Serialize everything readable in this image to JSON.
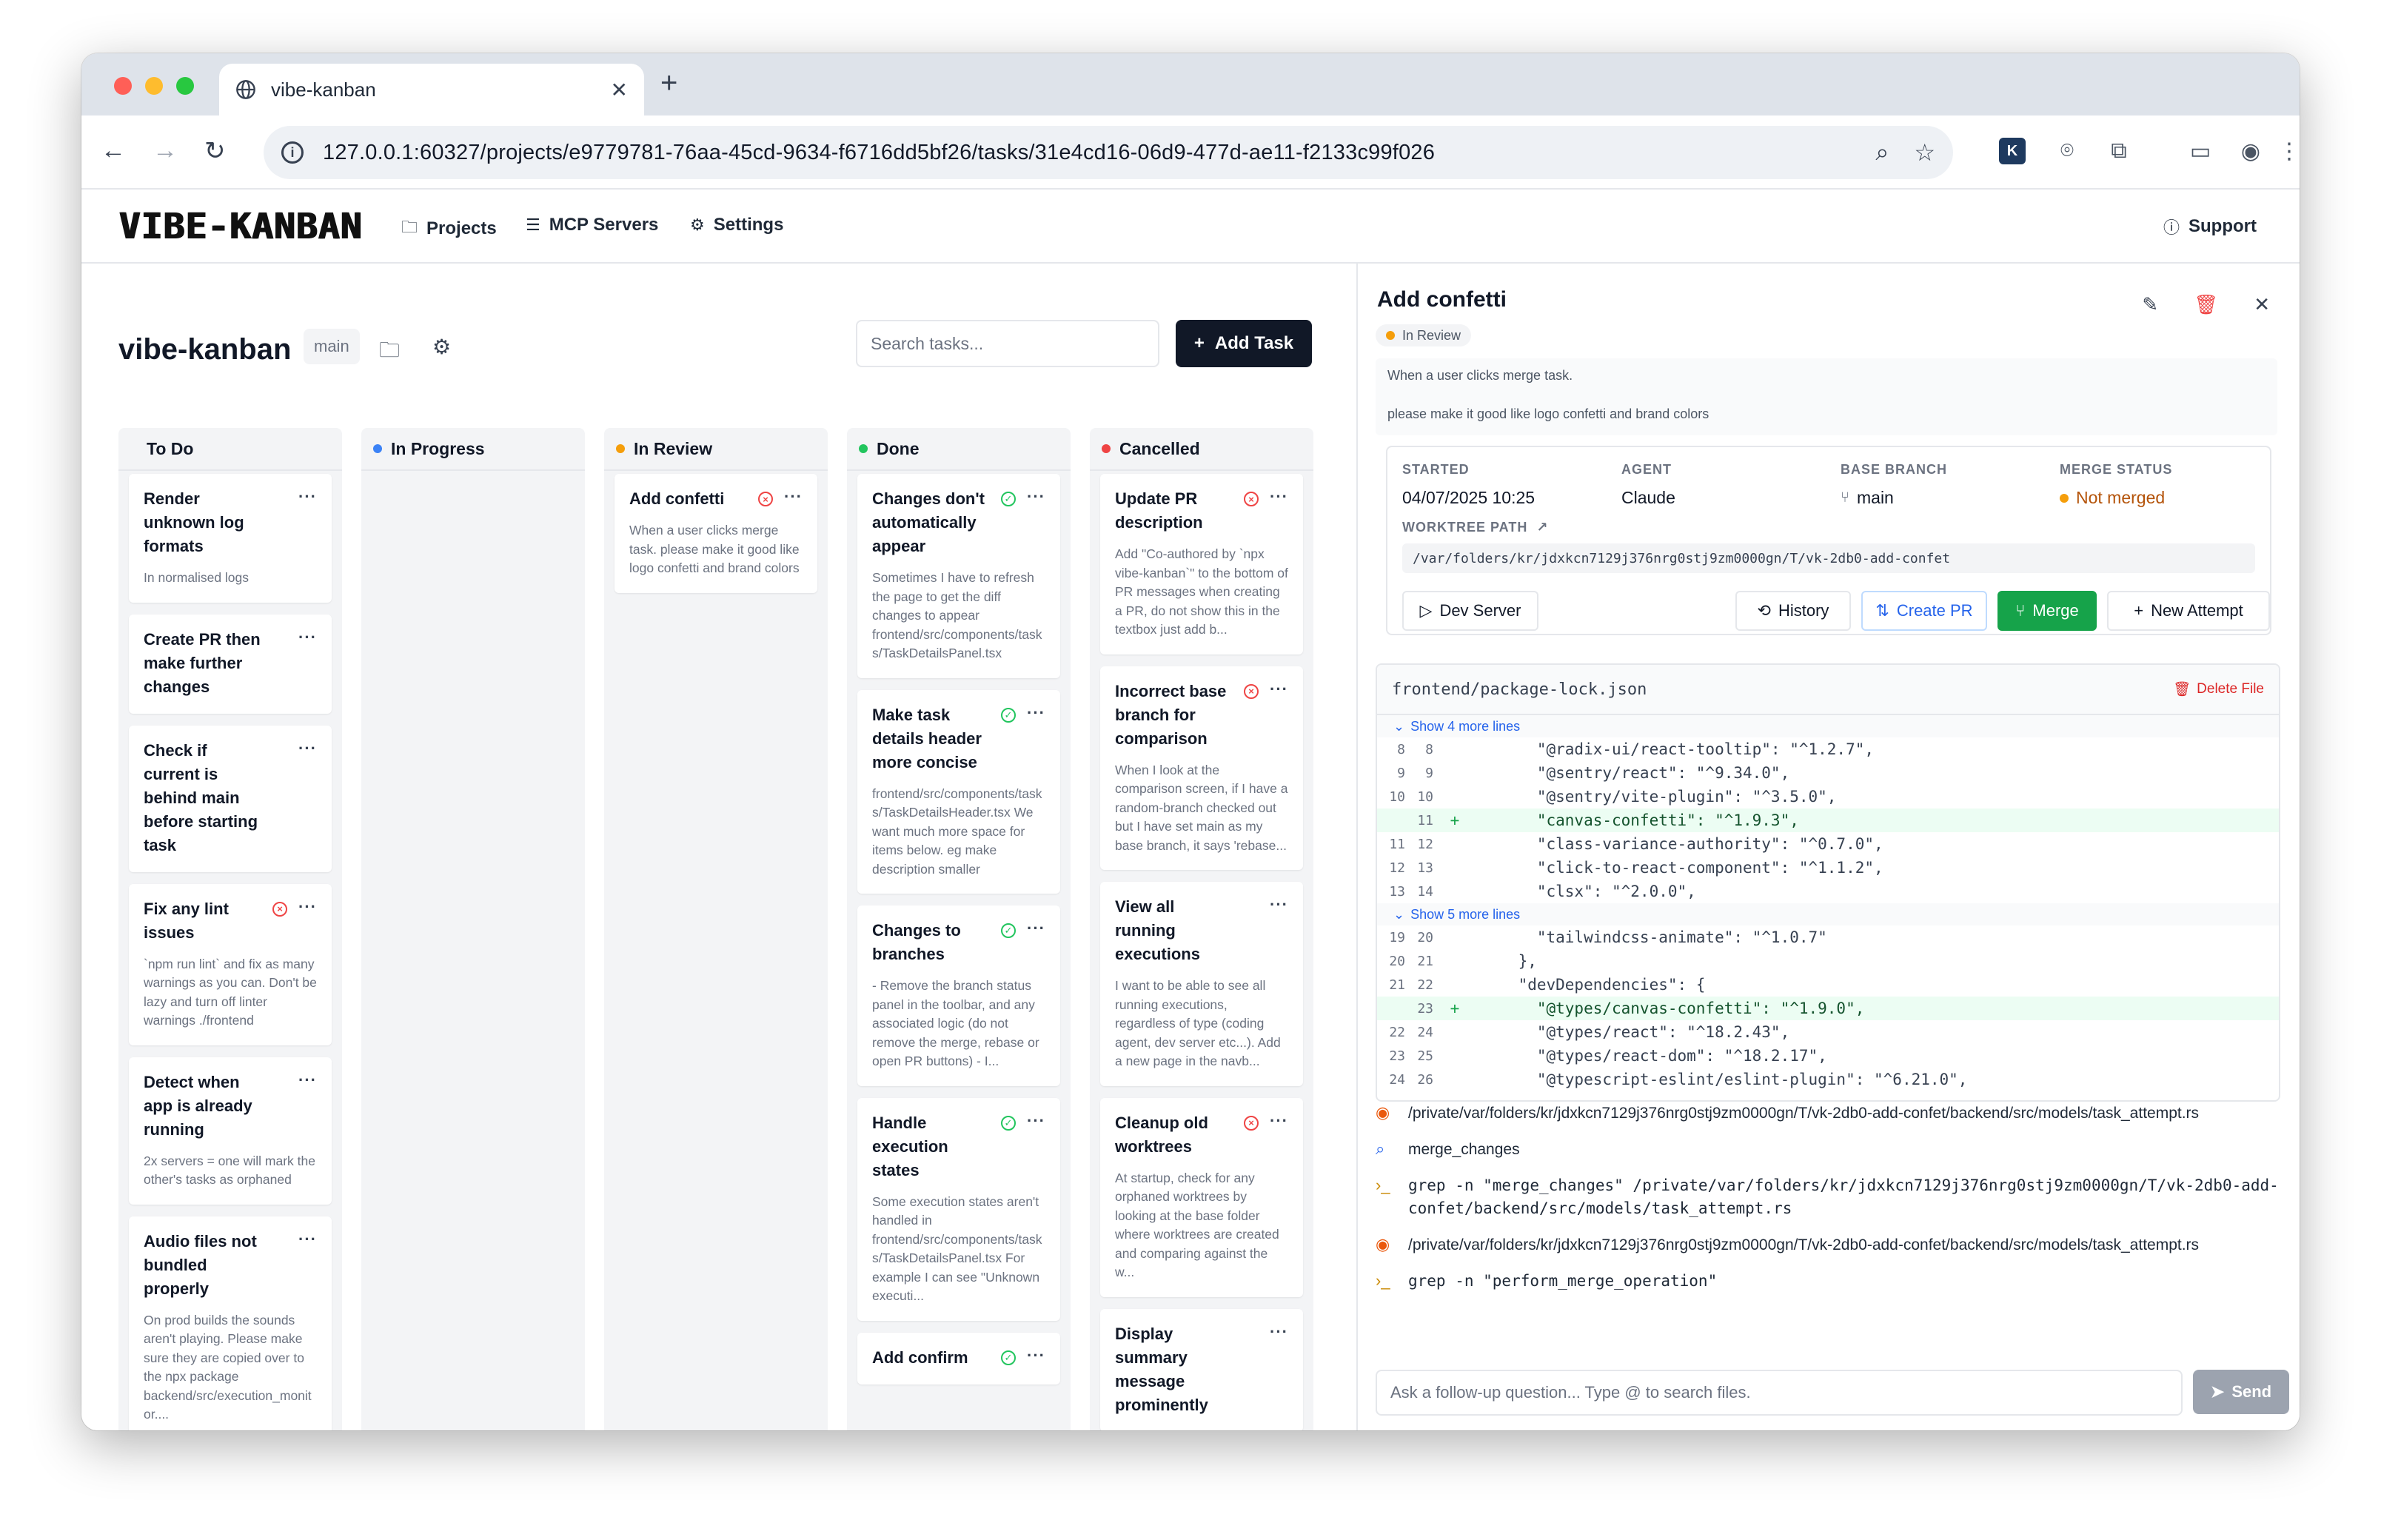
{
  "browser": {
    "tab_title": "vibe-kanban",
    "url": "127.0.0.1:60327/projects/e9779781-76aa-45cd-9634-f6716dd5bf26/tasks/31e4cd16-06d9-477d-ae11-f2133c99f026"
  },
  "app": {
    "logo": "VIBE-KANBAN",
    "nav": {
      "projects": "Projects",
      "mcp": "MCP Servers",
      "settings": "Settings",
      "support": "Support"
    }
  },
  "project": {
    "name": "vibe-kanban",
    "branch": "main",
    "search_placeholder": "Search tasks...",
    "add_task": "Add Task"
  },
  "colors": {
    "todo": "#9ca3af",
    "inprogress": "#3b82f6",
    "inreview": "#f59e0b",
    "done": "#22c55e",
    "cancelled": "#ef4444",
    "merge": "#16a34a"
  },
  "columns": [
    {
      "title": "To Do",
      "cards": [
        {
          "title": "Render unknown log formats",
          "desc": "In normalised logs",
          "status": ""
        },
        {
          "title": "Create PR then make further changes",
          "desc": "",
          "status": ""
        },
        {
          "title": "Check if current is behind main before starting task",
          "desc": "",
          "status": ""
        },
        {
          "title": "Fix any lint issues",
          "desc": "`npm run lint` and fix as many warnings as you can. Don't be lazy and turn off linter warnings ./frontend",
          "status": "failed"
        },
        {
          "title": "Detect when app is already running",
          "desc": "2x servers = one will mark the other's tasks as orphaned",
          "status": ""
        },
        {
          "title": "Audio files not bundled properly",
          "desc": "On prod builds the sounds aren't playing. Please make sure they are copied over to the npx package backend/src/execution_monitor....",
          "status": ""
        }
      ]
    },
    {
      "title": "In Progress",
      "cards": []
    },
    {
      "title": "In Review",
      "cards": [
        {
          "title": "Add confetti",
          "desc": "When a user clicks merge task. please make it good like logo confetti and brand colors",
          "status": "failed"
        }
      ]
    },
    {
      "title": "Done",
      "cards": [
        {
          "title": "Changes don't automatically appear",
          "desc": "Sometimes I have to refresh the page to get the diff changes to appear frontend/src/components/tasks/TaskDetailsPanel.tsx",
          "status": "done"
        },
        {
          "title": "Make task details header more concise",
          "desc": "frontend/src/components/tasks/TaskDetailsHeader.tsx We want much more space for items below. eg make description smaller",
          "status": "done"
        },
        {
          "title": "Changes to branches",
          "desc": "- Remove the branch status panel in the toolbar, and any associated logic (do not remove the merge, rebase or open PR buttons) - I...",
          "status": "done"
        },
        {
          "title": "Handle execution states",
          "desc": "Some execution states aren't handled in frontend/src/components/tasks/TaskDetailsPanel.tsx For example I can see \"Unknown executi...",
          "status": "done"
        },
        {
          "title": "Add confirm",
          "desc": "",
          "status": "done"
        }
      ]
    },
    {
      "title": "Cancelled",
      "cards": [
        {
          "title": "Update PR description",
          "desc": "Add \"Co-authored by `npx vibe-kanban`\" to the bottom of PR messages when creating a PR, do not show this in the textbox just add b...",
          "status": "failed"
        },
        {
          "title": "Incorrect base branch for comparison",
          "desc": "When I look at the comparison screen, if I have a random-branch checked out but I have set main as my base branch, it says 'rebase...",
          "status": "failed"
        },
        {
          "title": "View all running executions",
          "desc": "I want to be able to see all running executions, regardless of type (coding agent, dev server etc...). Add a new page in the navb...",
          "status": ""
        },
        {
          "title": "Cleanup old worktrees",
          "desc": "At startup, check for any orphaned worktrees by looking at the base folder where worktrees are created and comparing against the w...",
          "status": "failed"
        },
        {
          "title": "Display summary message prominently",
          "desc": "",
          "status": ""
        }
      ]
    }
  ],
  "task": {
    "title": "Add confetti",
    "status": "In Review",
    "description": [
      "When a user clicks merge task.",
      "please make it good like logo confetti and brand colors"
    ],
    "started_label": "STARTED",
    "started": "04/07/2025 10:25",
    "agent_label": "AGENT",
    "agent": "Claude",
    "base_label": "BASE BRANCH",
    "base": "main",
    "merge_label": "MERGE STATUS",
    "merge": "Not merged",
    "worktree_label": "WORKTREE PATH",
    "worktree": "/var/folders/kr/jdxkcn7129j376nrg0stj9zm0000gn/T/vk-2db0-add-confet",
    "buttons": {
      "dev": "Dev Server",
      "history": "History",
      "pr": "Create PR",
      "merge": "Merge",
      "attempt": "New Attempt"
    }
  },
  "diff": {
    "file": "frontend/package-lock.json",
    "delete": "Delete File",
    "expand1": "Show 4 more lines",
    "expand2": "Show 5 more lines",
    "hunk1": [
      {
        "a": "8",
        "b": "8",
        "sign": "",
        "code": "      \"@radix-ui/react-tooltip\": \"^1.2.7\","
      },
      {
        "a": "9",
        "b": "9",
        "sign": "",
        "code": "      \"@sentry/react\": \"^9.34.0\","
      },
      {
        "a": "10",
        "b": "10",
        "sign": "",
        "code": "      \"@sentry/vite-plugin\": \"^3.5.0\","
      },
      {
        "a": "",
        "b": "11",
        "sign": "+",
        "code": "      \"canvas-confetti\": \"^1.9.3\","
      },
      {
        "a": "11",
        "b": "12",
        "sign": "",
        "code": "      \"class-variance-authority\": \"^0.7.0\","
      },
      {
        "a": "12",
        "b": "13",
        "sign": "",
        "code": "      \"click-to-react-component\": \"^1.1.2\","
      },
      {
        "a": "13",
        "b": "14",
        "sign": "",
        "code": "      \"clsx\": \"^2.0.0\","
      }
    ],
    "hunk2": [
      {
        "a": "19",
        "b": "20",
        "sign": "",
        "code": "      \"tailwindcss-animate\": \"^1.0.7\""
      },
      {
        "a": "20",
        "b": "21",
        "sign": "",
        "code": "    },"
      },
      {
        "a": "21",
        "b": "22",
        "sign": "",
        "code": "    \"devDependencies\": {"
      },
      {
        "a": "",
        "b": "23",
        "sign": "+",
        "code": "      \"@types/canvas-confetti\": \"^1.9.0\","
      },
      {
        "a": "22",
        "b": "24",
        "sign": "",
        "code": "      \"@types/react\": \"^18.2.43\","
      },
      {
        "a": "23",
        "b": "25",
        "sign": "",
        "code": "      \"@types/react-dom\": \"^18.2.17\","
      },
      {
        "a": "24",
        "b": "26",
        "sign": "",
        "code": "      \"@typescript-eslint/eslint-plugin\": \"^6.21.0\","
      }
    ]
  },
  "log": [
    {
      "icon": "eye-icon",
      "text": "/private/var/folders/kr/jdxkcn7129j376nrg0stj9zm0000gn/T/vk-2db0-add-confet/backend/src/models/task_attempt.rs",
      "mono": false
    },
    {
      "icon": "search-icon",
      "text": "merge_changes",
      "mono": false
    },
    {
      "icon": "terminal-icon",
      "text": "grep -n \"merge_changes\" /private/var/folders/kr/jdxkcn7129j376nrg0stj9zm0000gn/T/vk-2db0-add-confet/backend/src/models/task_attempt.rs",
      "mono": true
    },
    {
      "icon": "eye-icon",
      "text": "/private/var/folders/kr/jdxkcn7129j376nrg0stj9zm0000gn/T/vk-2db0-add-confet/backend/src/models/task_attempt.rs",
      "mono": false
    },
    {
      "icon": "terminal-icon",
      "text": "grep -n \"perform_merge_operation\"",
      "mono": true
    }
  ],
  "followup": {
    "placeholder": "Ask a follow-up question... Type @ to search files.",
    "send": "Send"
  }
}
